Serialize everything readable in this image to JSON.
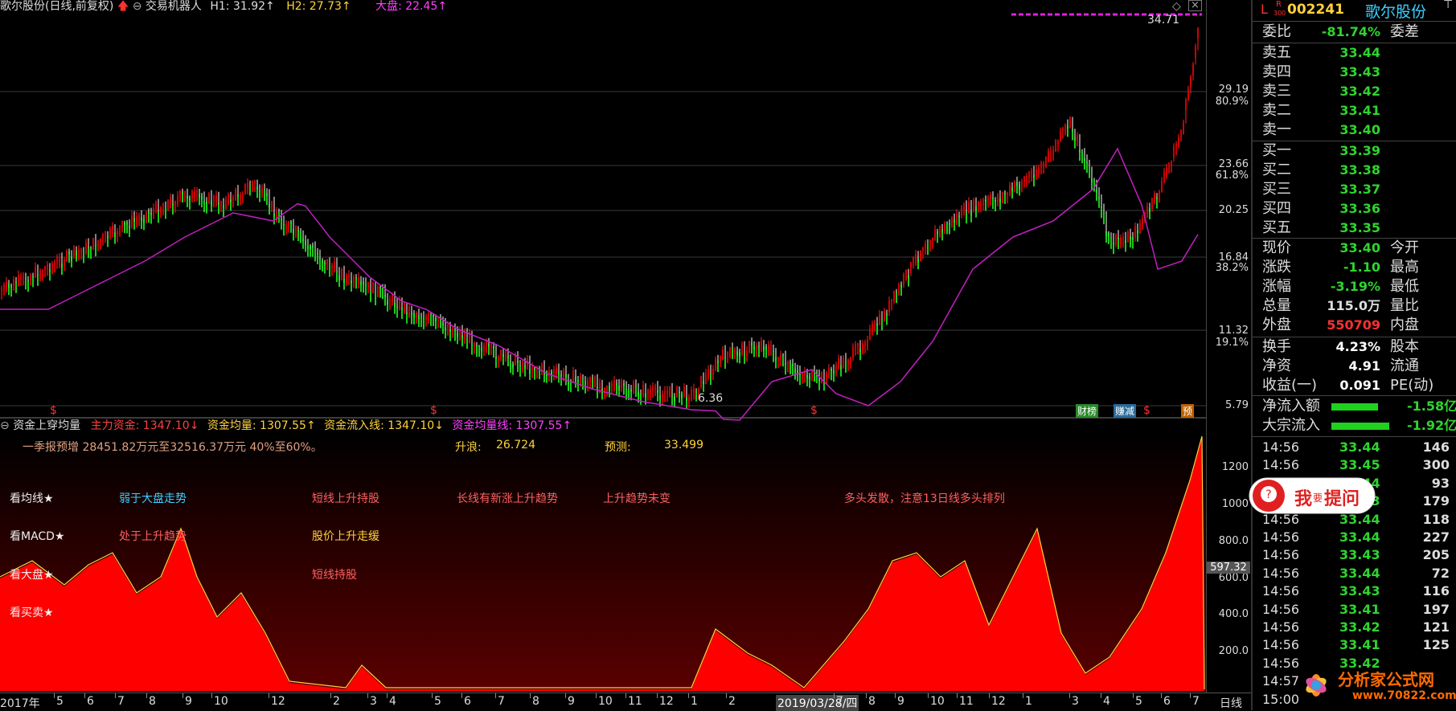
{
  "header": {
    "title": "歌尔股份(日线,前复权)",
    "indicator_name": "交易机器人",
    "h1": "H1: 31.92↑",
    "h2": "H2: 27.73↑",
    "dapan": "大盘: 22.45↑"
  },
  "price_axis": {
    "ticks": [
      "29.19",
      "80.9%",
      "23.66",
      "61.8%",
      "20.25",
      "16.84",
      "38.2%",
      "11.32",
      "19.1%",
      "5.79"
    ],
    "high_label": "34.71",
    "low_label": "6.36",
    "last_label": "597.32"
  },
  "markers": [
    "$",
    "$",
    "$",
    "财榜",
    "赚减",
    "$",
    "预"
  ],
  "lower_panel": {
    "name": "资金上穿均量",
    "main_fund": "主力资金: 1347.10↓",
    "fund_avg": "资金均量: 1307.55↑",
    "fund_inflow": "资金流入线: 1347.10↓",
    "fund_avg_line": "资金均量线: 1307.55↑",
    "forecast": "一季报预增 28451.82万元至32516.37万元 40%至60%。",
    "rise_label": "升浪:",
    "rise_value": "26.724",
    "pred_label": "预测:",
    "pred_value": "33.499",
    "ticks": [
      "1200",
      "1000",
      "800.0",
      "600.0",
      "400.0",
      "200.0"
    ],
    "row_labels": [
      "看均线★",
      "看MACD★",
      "看大盘★",
      "看买卖★"
    ],
    "row1": [
      "弱于大盘走势",
      "短线上升持股",
      "长线有新涨上升趋势",
      "上升趋势未变",
      "多头发散，注意13日线多头排列"
    ],
    "row2": [
      "处于上升趋势",
      "股价上升走缓"
    ],
    "row3": [
      "短线持股"
    ]
  },
  "date_axis": {
    "labels": [
      "2017年",
      "5",
      "6",
      "7",
      "8",
      "9",
      "10",
      "12",
      "2",
      "3",
      "4",
      "5",
      "6",
      "7",
      "8",
      "9",
      "10",
      "11",
      "12",
      "1",
      "2",
      "2019/03/28/四",
      "7",
      "8",
      "9",
      "10",
      "11",
      "12",
      "1",
      "3",
      "4",
      "5",
      "6",
      "7",
      "日线"
    ]
  },
  "sidebar": {
    "flag_l": "L",
    "flag_r": "R",
    "flag_300": "300",
    "code": "002241",
    "name": "歌尔股份",
    "weibi_label": "委比",
    "weibi_value": "-81.74%",
    "weicha_label": "委差",
    "asks": [
      {
        "label": "卖五",
        "price": "33.44"
      },
      {
        "label": "卖四",
        "price": "33.43"
      },
      {
        "label": "卖三",
        "price": "33.42"
      },
      {
        "label": "卖二",
        "price": "33.41"
      },
      {
        "label": "卖一",
        "price": "33.40"
      }
    ],
    "bids": [
      {
        "label": "买一",
        "price": "33.39"
      },
      {
        "label": "买二",
        "price": "33.38"
      },
      {
        "label": "买三",
        "price": "33.37"
      },
      {
        "label": "买四",
        "price": "33.36"
      },
      {
        "label": "买五",
        "price": "33.35"
      }
    ],
    "stats": [
      {
        "label": "现价",
        "value": "33.40",
        "label2": "今开"
      },
      {
        "label": "涨跌",
        "value": "-1.10",
        "label2": "最高"
      },
      {
        "label": "涨幅",
        "value": "-3.19%",
        "label2": "最低"
      },
      {
        "label": "总量",
        "value": "115.0万",
        "label2": "量比"
      },
      {
        "label": "外盘",
        "value": "550709",
        "label2": "内盘"
      }
    ],
    "stats2": [
      {
        "label": "换手",
        "value": "4.23%",
        "label2": "股本"
      },
      {
        "label": "净资",
        "value": "4.91",
        "label2": "流通"
      },
      {
        "label": "收益(一)",
        "value": "0.091",
        "label2": "PE(动)"
      }
    ],
    "netflow_label": "净流入额",
    "netflow_value": "-1.58亿",
    "bigflow_label": "大宗流入",
    "bigflow_value": "-1.92亿",
    "trades": [
      {
        "t": "14:56",
        "p": "33.44",
        "v": "146"
      },
      {
        "t": "14:56",
        "p": "33.45",
        "v": "300"
      },
      {
        "t": "14:56",
        "p": "33.44",
        "v": "93"
      },
      {
        "t": "14:56",
        "p": "33.43",
        "v": "179"
      },
      {
        "t": "14:56",
        "p": "33.44",
        "v": "118"
      },
      {
        "t": "14:56",
        "p": "33.44",
        "v": "227"
      },
      {
        "t": "14:56",
        "p": "33.43",
        "v": "205"
      },
      {
        "t": "14:56",
        "p": "33.44",
        "v": "72"
      },
      {
        "t": "14:56",
        "p": "33.43",
        "v": "116"
      },
      {
        "t": "14:56",
        "p": "33.41",
        "v": "197"
      },
      {
        "t": "14:56",
        "p": "33.42",
        "v": "121"
      },
      {
        "t": "14:56",
        "p": "33.41",
        "v": "125"
      },
      {
        "t": "14:56",
        "p": "33.42",
        "v": ""
      },
      {
        "t": "14:57",
        "p": "",
        "v": ""
      },
      {
        "t": "15:00",
        "p": "",
        "v": ""
      }
    ]
  },
  "ask_button": {
    "label1": "我",
    "label2": "要",
    "label3": "提问"
  },
  "watermark": {
    "line1": "分析家公式网",
    "line2": "www.70822.com"
  },
  "colors": {
    "up": "#ff2020",
    "down": "#20ff20",
    "ma": "#c020c0",
    "accent": "#ffd23c"
  }
}
